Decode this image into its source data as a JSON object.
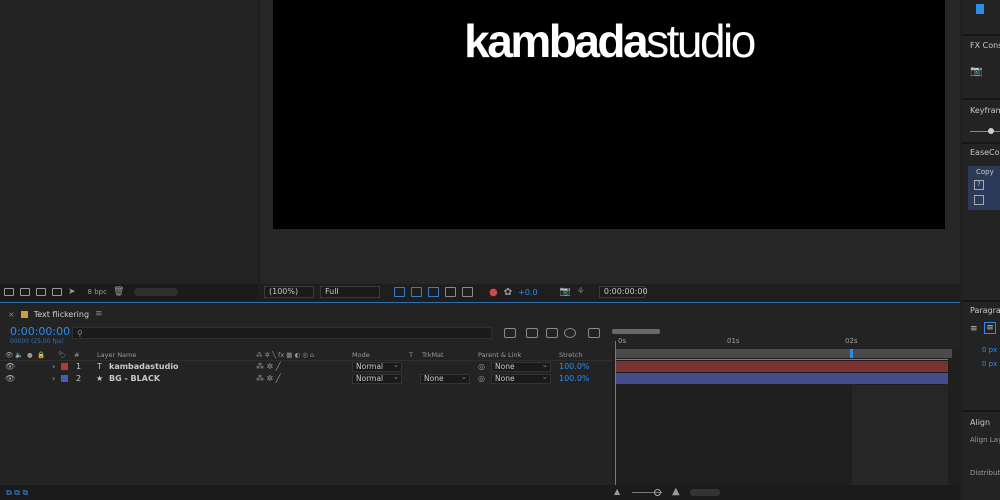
{
  "project_panel": {
    "bpc": "8 bpc"
  },
  "viewer": {
    "brand_bold": "kambada",
    "brand_thin": "studio",
    "zoom": "(100%)",
    "resolution": "Full",
    "exposure": "+0.0",
    "timecode": "0:00:00:00"
  },
  "right_panels": {
    "fx_console": "FX Conso",
    "keyframe": "Keyfram",
    "easecopy": "EaseCop",
    "copy": "Copy",
    "paragraph": "Paragra",
    "px1": "0 px",
    "px2": "0 px",
    "align": "Align",
    "align_layers": "Align Lay",
    "distribute": "Distribute"
  },
  "timeline": {
    "comp_name": "Text flickering",
    "timecode": "0:00:00:00",
    "fps": "00000 (25.00 fps)",
    "ruler": [
      "0s",
      "01s",
      "02s"
    ],
    "headers": {
      "num": "#",
      "layer_name": "Layer Name",
      "mode": "Mode",
      "t": "T",
      "trkmat": "TrkMat",
      "parent": "Parent & Link",
      "stretch": "Stretch"
    },
    "layers": [
      {
        "num": "1",
        "type_icon": "T",
        "name": "kambadastudio",
        "mode": "Normal",
        "trkmat": "",
        "parent": "None",
        "stretch": "100.0%",
        "color": "#b23a3a"
      },
      {
        "num": "2",
        "type_icon": "★",
        "name": "BG - BLACK",
        "mode": "Normal",
        "trkmat": "None",
        "parent": "None",
        "stretch": "100.0%",
        "color": "#4a5ab8"
      }
    ]
  }
}
